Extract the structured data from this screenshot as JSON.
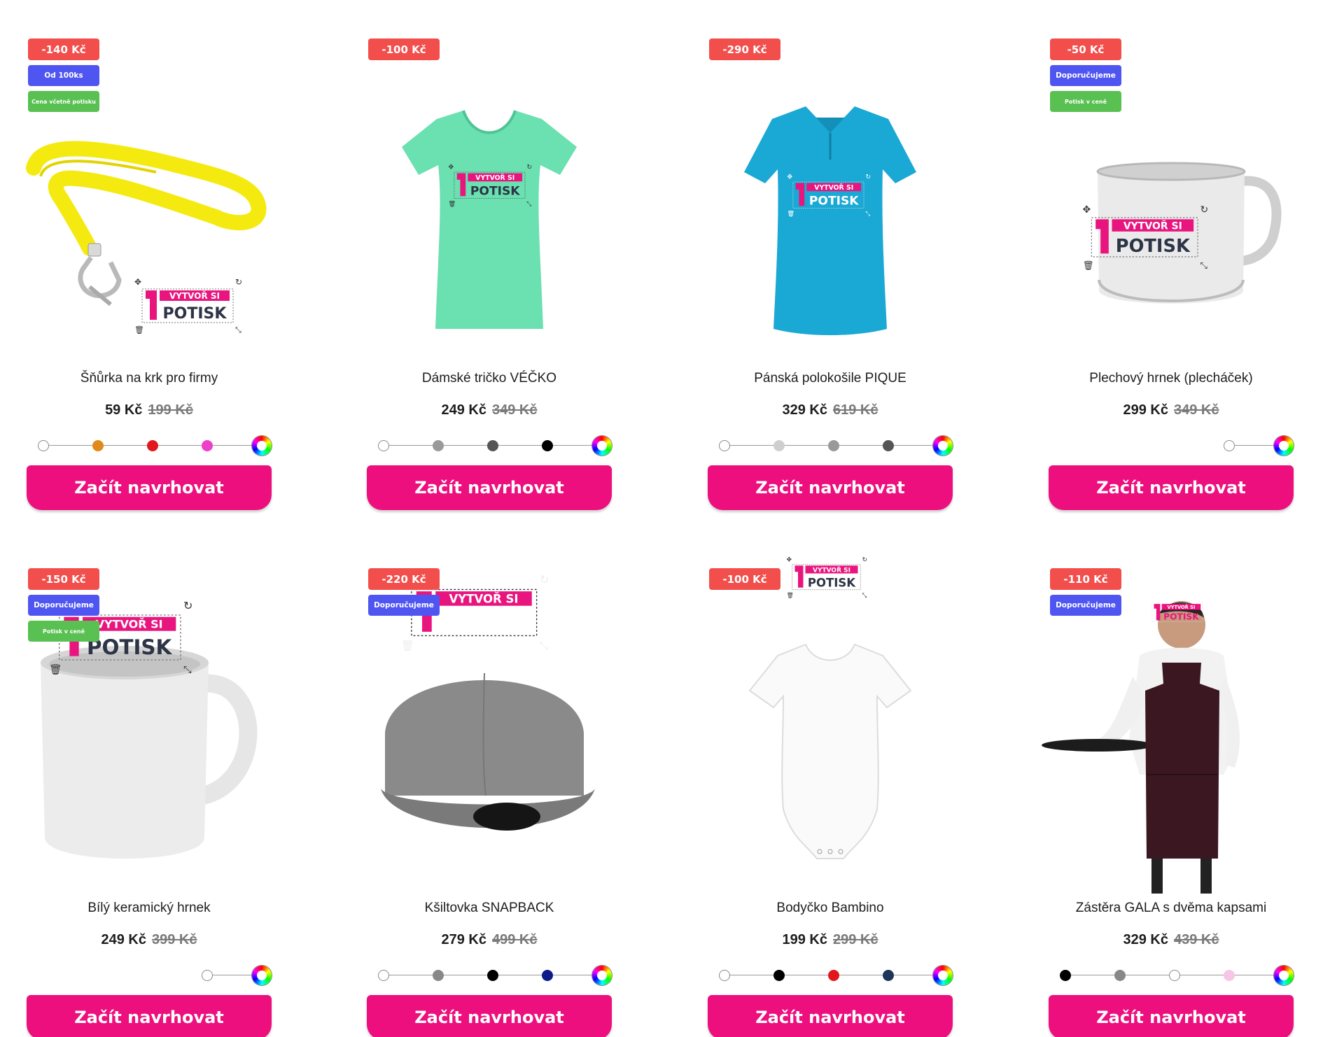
{
  "colors": {
    "accent": "#ed0f7d",
    "discount": "#f24e4c",
    "info": "#4f55f0",
    "print": "#59c052"
  },
  "logo": {
    "line1": "VYTVOŘ SI",
    "line2": "POTISK"
  },
  "products": [
    {
      "name": "Šňůrka na krk pro firmy",
      "price": "59 Kč",
      "old_price": "199 Kč",
      "badges": [
        {
          "type": "discount",
          "text": "-140 Kč"
        },
        {
          "type": "info",
          "text": "Od 100ks"
        },
        {
          "type": "print",
          "text": "Cena včetně potisku"
        }
      ],
      "colors": [
        "#ffffff",
        "#e08a1a",
        "#e0171b",
        "#ee3fc9"
      ],
      "button": "Začít navrhovat"
    },
    {
      "name": "Dámské tričko VÉČKO",
      "price": "249 Kč",
      "old_price": "349 Kč",
      "badges": [
        {
          "type": "discount",
          "text": "-100 Kč"
        }
      ],
      "colors": [
        "#ffffff",
        "#9a9a9a",
        "#555555",
        "#000000"
      ],
      "button": "Začít navrhovat"
    },
    {
      "name": "Pánská polokošile PIQUE",
      "price": "329 Kč",
      "old_price": "619 Kč",
      "badges": [
        {
          "type": "discount",
          "text": "-290 Kč"
        }
      ],
      "colors": [
        "#ffffff",
        "#cfcfcf",
        "#999999",
        "#555555"
      ],
      "button": "Začít navrhovat"
    },
    {
      "name": "Plechový hrnek (plecháček)",
      "price": "299 Kč",
      "old_price": "349 Kč",
      "badges": [
        {
          "type": "discount",
          "text": "-50 Kč"
        },
        {
          "type": "info",
          "text": "Doporučujeme"
        },
        {
          "type": "print",
          "text": "Potisk v ceně"
        }
      ],
      "colors": [
        "#ffffff"
      ],
      "button": "Začít navrhovat"
    },
    {
      "name": "Bílý keramický hrnek",
      "price": "249 Kč",
      "old_price": "399 Kč",
      "badges": [
        {
          "type": "discount",
          "text": "-150 Kč"
        },
        {
          "type": "info",
          "text": "Doporučujeme"
        },
        {
          "type": "print",
          "text": "Potisk v ceně"
        }
      ],
      "colors": [
        "#ffffff"
      ],
      "button": "Začít navrhovat"
    },
    {
      "name": "Kšiltovka SNAPBACK",
      "price": "279 Kč",
      "old_price": "499 Kč",
      "badges": [
        {
          "type": "discount",
          "text": "-220 Kč"
        },
        {
          "type": "info",
          "text": "Doporučujeme"
        }
      ],
      "colors": [
        "#ffffff",
        "#888888",
        "#000000",
        "#0d1a8a"
      ],
      "button": "Začít navrhovat"
    },
    {
      "name": "Bodyčko Bambino",
      "price": "199 Kč",
      "old_price": "299 Kč",
      "badges": [
        {
          "type": "discount",
          "text": "-100 Kč"
        }
      ],
      "colors": [
        "#ffffff",
        "#000000",
        "#e0171b",
        "#1c3558"
      ],
      "button": "Začít navrhovat"
    },
    {
      "name": "Zástěra GALA s dvěma kapsami",
      "price": "329 Kč",
      "old_price": "439 Kč",
      "badges": [
        {
          "type": "discount",
          "text": "-110 Kč"
        },
        {
          "type": "info",
          "text": "Doporučujeme"
        }
      ],
      "colors": [
        "#000000",
        "#888888",
        "#ffffff",
        "#f6c6e6"
      ],
      "button": "Začít navrhovat"
    }
  ]
}
